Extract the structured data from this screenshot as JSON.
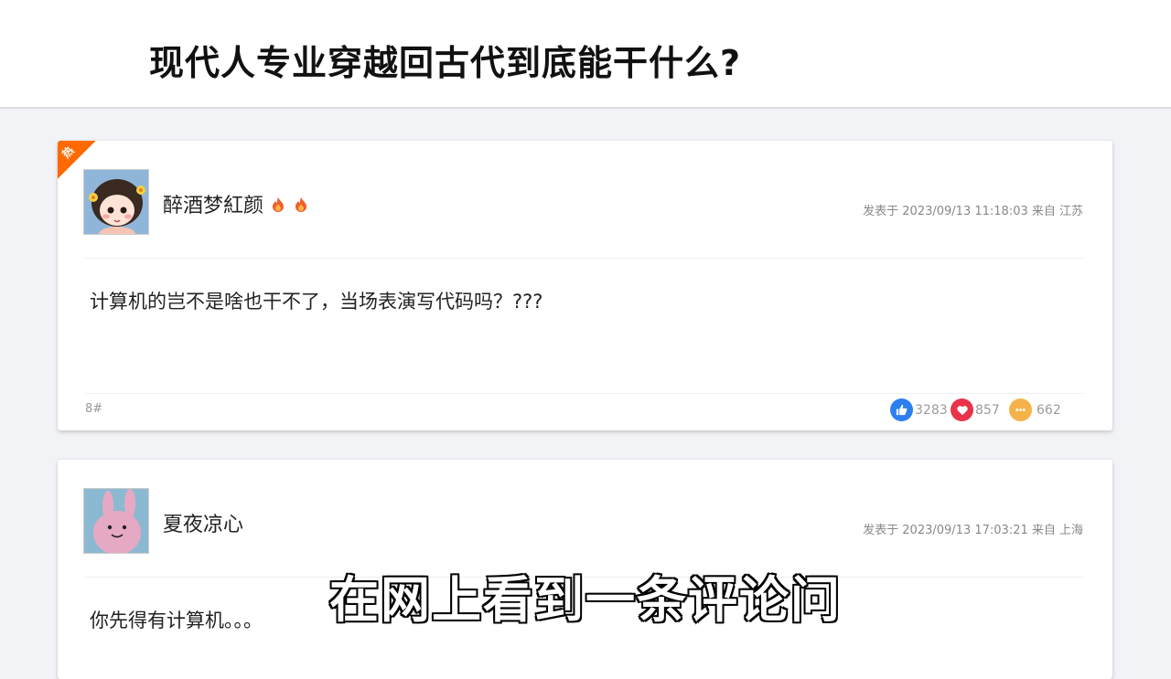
{
  "header": {
    "title": "现代人专业穿越回古代到底能干什么?"
  },
  "comments": [
    {
      "hot_label": "热",
      "username": "醉酒梦紅颜",
      "meta": "发表于 2023/09/13 11:18:03 来自 江苏",
      "content": "计算机的岂不是啥也干不了，当场表演写代码吗？???",
      "floor": "8#",
      "likes": "3283",
      "hearts": "857",
      "replies": "662"
    },
    {
      "username": "夏夜凉心",
      "meta": "发表于 2023/09/13 17:03:21 来自 上海",
      "content": "你先得有计算机。。。"
    }
  ],
  "subtitle": "在网上看到一条评论问",
  "colors": {
    "like": "#2d7ff0",
    "heart": "#e8334a",
    "reply": "#f5b24a",
    "hot": "#ff6a00"
  }
}
